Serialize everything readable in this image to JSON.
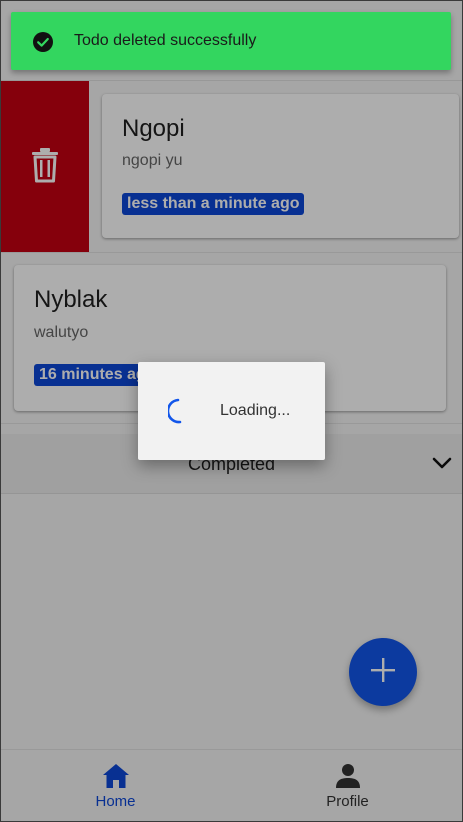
{
  "toast": {
    "message": "Todo deleted successfully",
    "icon": "check-circle-icon",
    "color": "#33d65f"
  },
  "todos": [
    {
      "title": "Ngopi",
      "subtitle": "ngopi yu",
      "time": "less than a minute ago",
      "swipe_action_icon": "trash-icon",
      "swipe_action_color": "#c40012"
    },
    {
      "title": "Nyblak",
      "subtitle": "walutyo",
      "time": "16 minutes ago"
    }
  ],
  "completed_section": {
    "label": "Completed",
    "icon": "chevron-down-icon"
  },
  "loading": {
    "text": "Loading...",
    "icon": "spinner-icon"
  },
  "fab": {
    "icon": "plus-icon",
    "color": "#1256ea"
  },
  "bottom_nav": {
    "items": [
      {
        "label": "Home",
        "icon": "home-icon",
        "active": true
      },
      {
        "label": "Profile",
        "icon": "person-icon",
        "active": false
      }
    ],
    "active_color": "#0d47d8"
  },
  "accent_color": "#0d47d8"
}
